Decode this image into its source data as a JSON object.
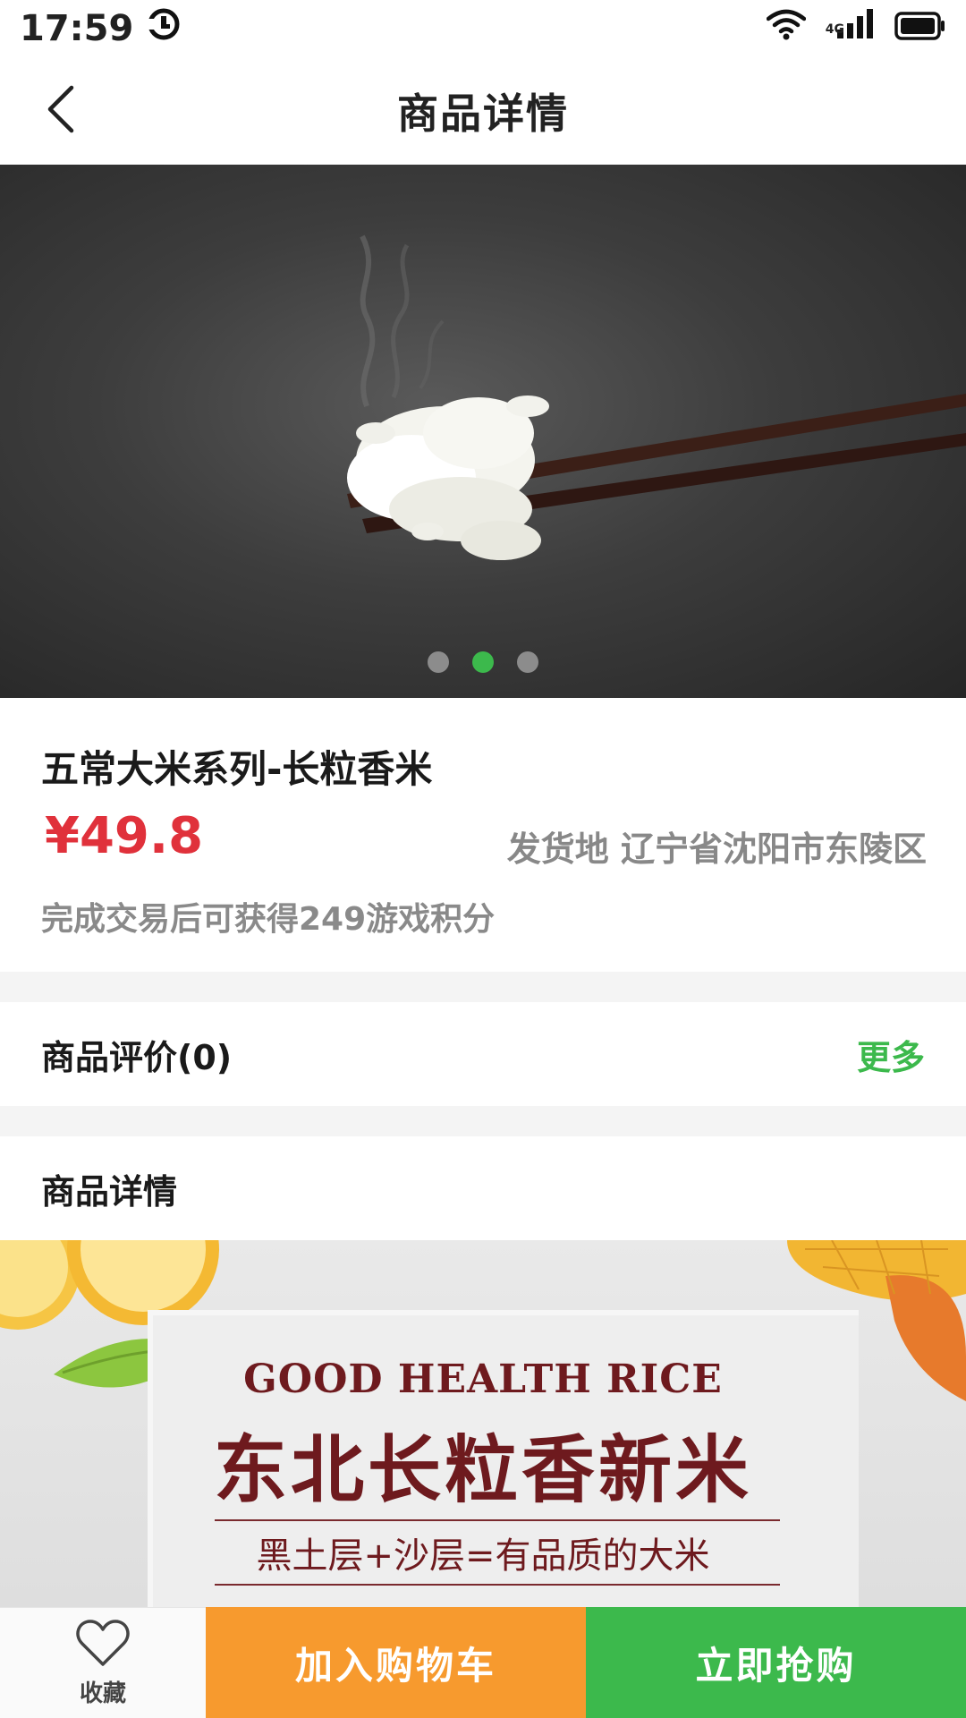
{
  "status_bar": {
    "time": "17:59",
    "network": "4G",
    "icons": [
      "sync-icon",
      "wifi-icon",
      "signal-icon",
      "battery-icon"
    ]
  },
  "nav": {
    "title": "商品详情",
    "back_icon": "chevron-left-icon"
  },
  "carousel": {
    "image": "rice-on-chopsticks-photo",
    "slide_count": 3,
    "active_index": 1,
    "active_color": "#3cb94c"
  },
  "product": {
    "name": "五常大米系列-长粒香米",
    "price": "¥49.8",
    "price_color": "#e0313b",
    "ship_from": "发货地 辽宁省沈阳市东陵区",
    "points_note": "完成交易后可获得249游戏积分"
  },
  "reviews": {
    "label": "商品评价(0)",
    "more": "更多",
    "more_color": "#3cb94c"
  },
  "detail": {
    "label": "商品详情",
    "banner": {
      "title_en": "GOOD HEALTH RICE",
      "title_cn": "东北长粒香新米",
      "subtitle": "黑土层+沙层=有品质的大米",
      "text_color": "#6e1a1e"
    }
  },
  "bottom_bar": {
    "favorite_icon": "heart-icon",
    "favorite_label": "收藏",
    "add_to_cart": "加入购物车",
    "add_to_cart_color": "#f79a2e",
    "buy_now": "立即抢购",
    "buy_now_color": "#3cb94c"
  }
}
